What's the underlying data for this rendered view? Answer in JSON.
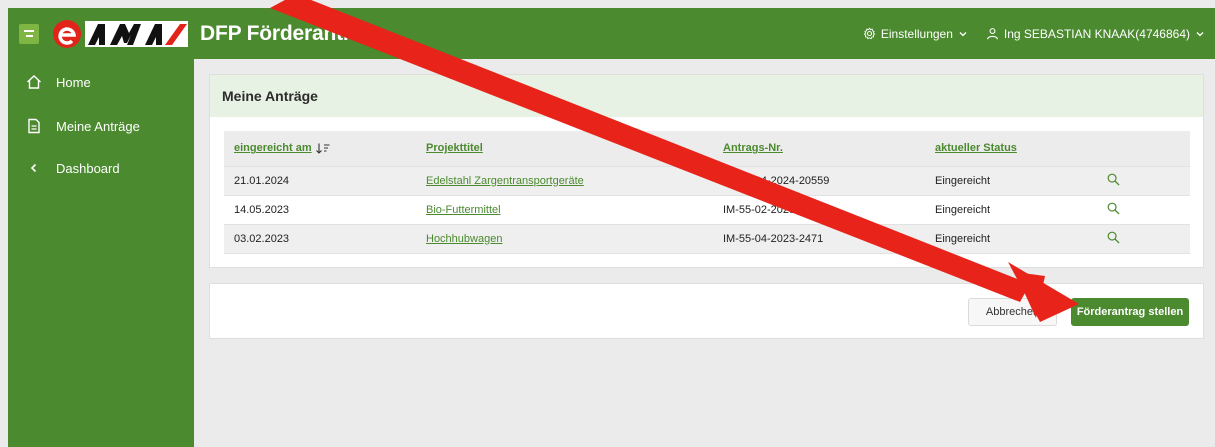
{
  "header": {
    "app_title": "DFP Förderantrag",
    "settings_label": "Einstellungen",
    "user_label": "Ing SEBASTIAN KNAAK(4746864)"
  },
  "sidebar": {
    "items": [
      {
        "label": "Home",
        "icon": "home-icon"
      },
      {
        "label": "Meine Anträge",
        "icon": "document-icon"
      },
      {
        "label": "Dashboard",
        "icon": "chevron-left-icon"
      }
    ]
  },
  "main": {
    "card_title": "Meine Anträge",
    "columns": [
      "eingereicht am",
      "Projekttitel",
      "Antrags-Nr.",
      "aktueller Status"
    ],
    "rows": [
      {
        "date": "21.01.2024",
        "title": "Edelstahl Zargentransportgeräte",
        "number": "IM-55-04-2024-20559",
        "status": "Eingereicht"
      },
      {
        "date": "14.05.2023",
        "title": "Bio-Futtermittel",
        "number": "IM-55-02-2023-7...",
        "status": "Eingereicht"
      },
      {
        "date": "03.02.2023",
        "title": "Hochhubwagen",
        "number": "IM-55-04-2023-2471",
        "status": "Eingereicht"
      }
    ]
  },
  "actions": {
    "cancel_label": "Abbrechen",
    "submit_label": "Förderantrag stellen"
  },
  "colors": {
    "brand_green": "#4b8a2f",
    "header_light_green": "#e7f1e4",
    "annotation_red": "#e8231a",
    "logo_red": "#e2231a"
  }
}
